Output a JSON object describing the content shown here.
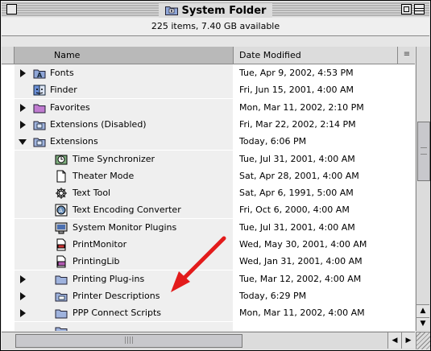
{
  "window": {
    "title": "System Folder",
    "title_icon": "system-folder-icon",
    "info_text": "225 items, 7.40 GB available"
  },
  "columns": {
    "name": "Name",
    "date_modified": "Date Modified"
  },
  "rows": [
    {
      "name": "Fonts",
      "date": "Tue, Apr 9, 2002, 4:53 PM",
      "expander": "right",
      "icon": "fonts-folder-icon",
      "level": 0
    },
    {
      "name": "Finder",
      "date": "Fri, Jun 15, 2001, 4:00 AM",
      "expander": "none",
      "icon": "finder-icon",
      "level": 0
    },
    {
      "name": "Favorites",
      "date": "Mon, Mar 11, 2002, 2:10 PM",
      "expander": "right",
      "icon": "favorites-folder-icon",
      "level": 0
    },
    {
      "name": "Extensions (Disabled)",
      "date": "Fri, Mar 22, 2002, 2:14 PM",
      "expander": "right",
      "icon": "extensions-disabled-folder-icon",
      "level": 0
    },
    {
      "name": "Extensions",
      "date": "Today, 6:06 PM",
      "expander": "down",
      "icon": "extensions-folder-icon",
      "level": 0
    },
    {
      "name": "Time Synchronizer",
      "date": "Tue, Jul 31, 2001, 4:00 AM",
      "expander": "none",
      "icon": "time-synchronizer-icon",
      "level": 1
    },
    {
      "name": "Theater Mode",
      "date": "Sat, Apr 28, 2001, 4:00 AM",
      "expander": "none",
      "icon": "document-icon",
      "level": 1
    },
    {
      "name": "Text Tool",
      "date": "Sat, Apr 6, 1991, 5:00 AM",
      "expander": "none",
      "icon": "text-tool-icon",
      "level": 1
    },
    {
      "name": "Text Encoding Converter",
      "date": "Fri, Oct 6, 2000, 4:00 AM",
      "expander": "none",
      "icon": "text-encoding-converter-icon",
      "level": 1
    },
    {
      "name": "System Monitor Plugins",
      "date": "Tue, Jul 31, 2001, 4:00 AM",
      "expander": "none",
      "icon": "system-monitor-plugins-icon",
      "level": 1
    },
    {
      "name": "PrintMonitor",
      "date": "Wed, May 30, 2001, 4:00 AM",
      "expander": "none",
      "icon": "print-monitor-icon",
      "level": 1
    },
    {
      "name": "PrintingLib",
      "date": "Wed, Jan 31, 2001, 4:00 AM",
      "expander": "none",
      "icon": "printing-lib-icon",
      "level": 1
    },
    {
      "name": "Printing Plug-ins",
      "date": "Tue, Mar 12, 2002, 4:00 AM",
      "expander": "right",
      "icon": "folder-icon",
      "level": 1
    },
    {
      "name": "Printer Descriptions",
      "date": "Today, 6:29 PM",
      "expander": "right",
      "icon": "printer-descriptions-folder-icon",
      "level": 1
    },
    {
      "name": "PPP Connect Scripts",
      "date": "Mon, Mar 11, 2002, 4:00 AM",
      "expander": "right",
      "icon": "folder-icon",
      "level": 1
    },
    {
      "name": "",
      "date": "",
      "expander": "none",
      "icon": "folder-icon",
      "level": 1
    }
  ],
  "colors": {
    "annotation_arrow": "#e31b1b",
    "name_column_bg": "#efefef",
    "header_selected": "#b9b9b9"
  }
}
